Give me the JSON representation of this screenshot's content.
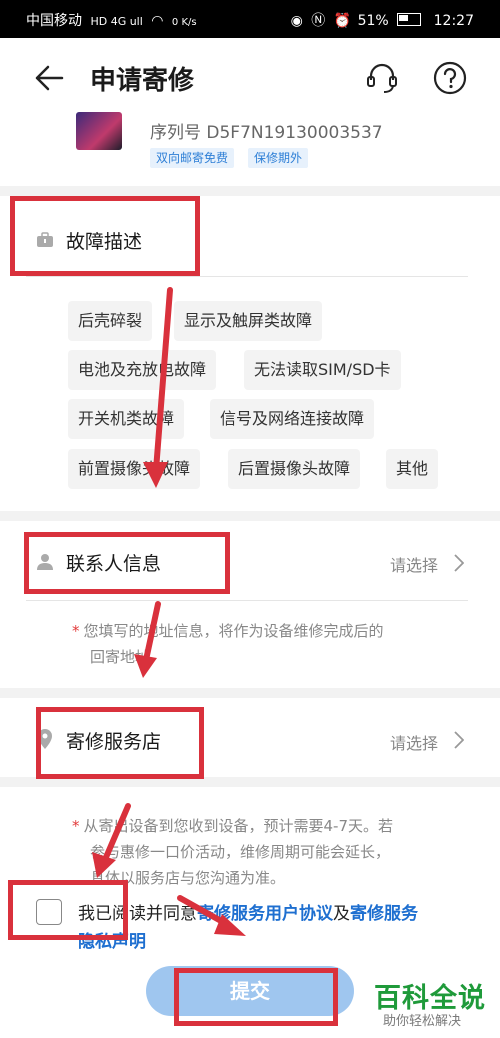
{
  "status_bar": {
    "carrier": "中国移动",
    "network": "HD 4G ull",
    "speed": "0 K/s",
    "battery": "51%",
    "time": "12:27"
  },
  "header": {
    "title": "申请寄修"
  },
  "device": {
    "serial": "序列号 D5F7N19130003537",
    "tags": [
      "双向邮寄免费",
      "保修期外"
    ]
  },
  "fault": {
    "title": "故障描述",
    "chips": [
      "后壳碎裂",
      "显示及触屏类故障",
      "电池及充放电故障",
      "无法读取SIM/SD卡",
      "开关机类故障",
      "信号及网络连接故障",
      "前置摄像头故障",
      "后置摄像头故障",
      "其他"
    ]
  },
  "contact": {
    "title": "联系人信息",
    "choose": "请选择",
    "note_line1": "您填写的地址信息，将作为设备维修完成后的",
    "note_line2": "回寄地址"
  },
  "store": {
    "title": "寄修服务店",
    "choose": "请选择",
    "note_line1": "从寄出设备到您收到设备，预计需要4-7天。若",
    "note_line2": "参与惠修一口价活动，维修周期可能会延长，",
    "note_line3": "具体以服务店与您沟通为准。"
  },
  "agreement": {
    "prefix": "我已阅读并同意",
    "link1": "寄修服务用户协议",
    "and": "及",
    "link2_part1": "寄修服务",
    "link2_part2": "隐私声明"
  },
  "submit_label": "提交",
  "watermark": {
    "title": "百科全说",
    "subtitle": "助你轻松解决"
  },
  "colors": {
    "link": "#1e6fd0",
    "submit": "#9fc6ef",
    "annotation": "#d9313c",
    "watermark": "#1f9a3a"
  }
}
